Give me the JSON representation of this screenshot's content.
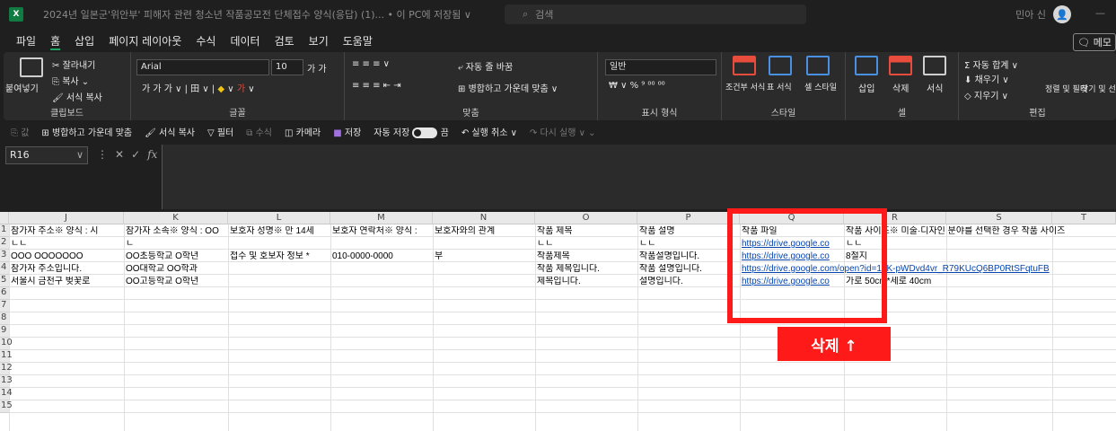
{
  "titlebar": {
    "app_icon": "X",
    "doc_title": "2024년 일본군'위안부' 피해자 관련 청소년 작품공모전 단체접수 양식(응답) (1)... • 이 PC에 저장됨 ∨",
    "search_placeholder": "검색",
    "user_name": "민아 신",
    "minimize": "—"
  },
  "menu": {
    "items": [
      "파일",
      "홈",
      "삽입",
      "페이지 레이아웃",
      "수식",
      "데이터",
      "검토",
      "보기",
      "도움말"
    ],
    "memo": "메모"
  },
  "ribbon": {
    "clipboard": {
      "paste": "붙여넣기",
      "cut": "잘라내기",
      "copy": "복사",
      "format_painter": "서식 복사",
      "label": "클립보드"
    },
    "font": {
      "name": "Arial",
      "size": "10",
      "label": "글꼴"
    },
    "alignment": {
      "wrap": "자동 줄 바꿈",
      "merge": "병합하고 가운데 맞춤",
      "label": "맞춤"
    },
    "number": {
      "format": "일반",
      "label": "표시 형식"
    },
    "styles": {
      "conditional": "조건부 서식",
      "table": "표 서식",
      "cell_style": "셀 스타일",
      "label": "스타일"
    },
    "cells": {
      "insert": "삽입",
      "delete": "삭제",
      "format": "서식",
      "label": "셀"
    },
    "editing": {
      "autosum": "자동 합계",
      "fill": "채우기",
      "clear": "지우기",
      "sort": "정렬 및 필터",
      "find": "찾기 및 선택",
      "label": "편집"
    }
  },
  "qat": {
    "value": "값",
    "merge": "병합하고 가운데 맞춤",
    "format_painter": "서식 복사",
    "filter": "필터",
    "formula": "수식",
    "camera": "카메라",
    "save": "저장",
    "autosave": "자동 저장",
    "autosave_state": "끔",
    "undo": "실행 취소",
    "redo": "다시 실행"
  },
  "formula_bar": {
    "name_box": "R16",
    "fx": "fx"
  },
  "sheet": {
    "columns": [
      "J",
      "K",
      "L",
      "M",
      "N",
      "O",
      "P",
      "Q",
      "R",
      "S",
      "T"
    ],
    "rows": [
      "1",
      "2",
      "3",
      "4",
      "5",
      "6",
      "7",
      "8",
      "9",
      "10",
      "11",
      "12",
      "13",
      "14",
      "15"
    ],
    "cells": {
      "J1": "참가자 주소※ 양식 : 시",
      "K1": "참가자 소속※ 양식 : OO",
      "L1": "보호자 성명※ 만 14세",
      "M1": "보호자 연락처※ 양식 :",
      "N1": "보호자와의 관계",
      "O1": "작품 제목",
      "P1": "작품 설명",
      "Q1": "작품 파일",
      "R1": "작품 사이즈※ 미술·디자인 분야를 선택한 경우 작품 사이즈",
      "J2": "ㄴㄴ",
      "K2": "ㄴ",
      "O2": "ㄴㄴ",
      "P2": "ㄴㄴ",
      "Q2": "https://drive.google.co",
      "R2": "ㄴㄴ",
      "J3": "OOO OOOOOOO",
      "K3": "OO초등학교 O학년",
      "L3": "접수 및 호보자 정보 *",
      "M3": "010-0000-0000",
      "N3": "부",
      "O3": "작품제목",
      "P3": "작품설명입니다.",
      "Q3": "https://drive.google.co",
      "R3": "8절지",
      "J4": "참가자 주소입니다.",
      "K4": "OO대학교 OO학과",
      "O4": "작품 제목입니다.",
      "P4": "작품 설명입니다.",
      "Q4": "https://drive.google.com/open?id=1gK-pWDvd4vr_R79KUcQ6BP0RtSFqtuFB",
      "J5": "서울시 금천구 벚꽃로",
      "K5": "OO고등학교 O학년",
      "O5": "제목입니다.",
      "P5": "설명입니다.",
      "Q5": "https://drive.google.co",
      "R5": "가로 50cm*세로 40cm"
    }
  },
  "annotation": {
    "label": "삭제 ↑",
    "color": "#ff1a1a"
  }
}
